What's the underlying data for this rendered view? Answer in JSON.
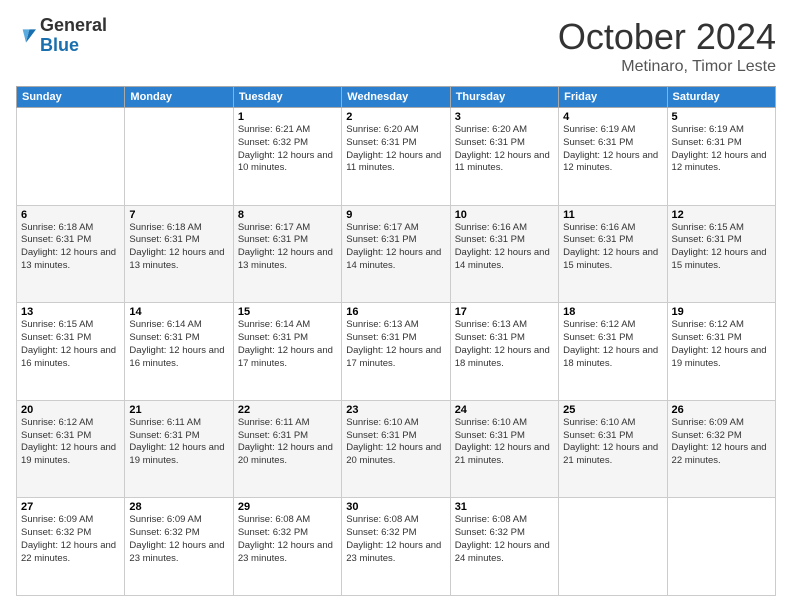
{
  "logo": {
    "general": "General",
    "blue": "Blue"
  },
  "header": {
    "month": "October 2024",
    "location": "Metinaro, Timor Leste"
  },
  "weekdays": [
    "Sunday",
    "Monday",
    "Tuesday",
    "Wednesday",
    "Thursday",
    "Friday",
    "Saturday"
  ],
  "weeks": [
    [
      {
        "day": null,
        "info": null
      },
      {
        "day": null,
        "info": null
      },
      {
        "day": "1",
        "info": "Sunrise: 6:21 AM\nSunset: 6:32 PM\nDaylight: 12 hours\nand 10 minutes."
      },
      {
        "day": "2",
        "info": "Sunrise: 6:20 AM\nSunset: 6:31 PM\nDaylight: 12 hours\nand 11 minutes."
      },
      {
        "day": "3",
        "info": "Sunrise: 6:20 AM\nSunset: 6:31 PM\nDaylight: 12 hours\nand 11 minutes."
      },
      {
        "day": "4",
        "info": "Sunrise: 6:19 AM\nSunset: 6:31 PM\nDaylight: 12 hours\nand 12 minutes."
      },
      {
        "day": "5",
        "info": "Sunrise: 6:19 AM\nSunset: 6:31 PM\nDaylight: 12 hours\nand 12 minutes."
      }
    ],
    [
      {
        "day": "6",
        "info": "Sunrise: 6:18 AM\nSunset: 6:31 PM\nDaylight: 12 hours\nand 13 minutes."
      },
      {
        "day": "7",
        "info": "Sunrise: 6:18 AM\nSunset: 6:31 PM\nDaylight: 12 hours\nand 13 minutes."
      },
      {
        "day": "8",
        "info": "Sunrise: 6:17 AM\nSunset: 6:31 PM\nDaylight: 12 hours\nand 13 minutes."
      },
      {
        "day": "9",
        "info": "Sunrise: 6:17 AM\nSunset: 6:31 PM\nDaylight: 12 hours\nand 14 minutes."
      },
      {
        "day": "10",
        "info": "Sunrise: 6:16 AM\nSunset: 6:31 PM\nDaylight: 12 hours\nand 14 minutes."
      },
      {
        "day": "11",
        "info": "Sunrise: 6:16 AM\nSunset: 6:31 PM\nDaylight: 12 hours\nand 15 minutes."
      },
      {
        "day": "12",
        "info": "Sunrise: 6:15 AM\nSunset: 6:31 PM\nDaylight: 12 hours\nand 15 minutes."
      }
    ],
    [
      {
        "day": "13",
        "info": "Sunrise: 6:15 AM\nSunset: 6:31 PM\nDaylight: 12 hours\nand 16 minutes."
      },
      {
        "day": "14",
        "info": "Sunrise: 6:14 AM\nSunset: 6:31 PM\nDaylight: 12 hours\nand 16 minutes."
      },
      {
        "day": "15",
        "info": "Sunrise: 6:14 AM\nSunset: 6:31 PM\nDaylight: 12 hours\nand 17 minutes."
      },
      {
        "day": "16",
        "info": "Sunrise: 6:13 AM\nSunset: 6:31 PM\nDaylight: 12 hours\nand 17 minutes."
      },
      {
        "day": "17",
        "info": "Sunrise: 6:13 AM\nSunset: 6:31 PM\nDaylight: 12 hours\nand 18 minutes."
      },
      {
        "day": "18",
        "info": "Sunrise: 6:12 AM\nSunset: 6:31 PM\nDaylight: 12 hours\nand 18 minutes."
      },
      {
        "day": "19",
        "info": "Sunrise: 6:12 AM\nSunset: 6:31 PM\nDaylight: 12 hours\nand 19 minutes."
      }
    ],
    [
      {
        "day": "20",
        "info": "Sunrise: 6:12 AM\nSunset: 6:31 PM\nDaylight: 12 hours\nand 19 minutes."
      },
      {
        "day": "21",
        "info": "Sunrise: 6:11 AM\nSunset: 6:31 PM\nDaylight: 12 hours\nand 19 minutes."
      },
      {
        "day": "22",
        "info": "Sunrise: 6:11 AM\nSunset: 6:31 PM\nDaylight: 12 hours\nand 20 minutes."
      },
      {
        "day": "23",
        "info": "Sunrise: 6:10 AM\nSunset: 6:31 PM\nDaylight: 12 hours\nand 20 minutes."
      },
      {
        "day": "24",
        "info": "Sunrise: 6:10 AM\nSunset: 6:31 PM\nDaylight: 12 hours\nand 21 minutes."
      },
      {
        "day": "25",
        "info": "Sunrise: 6:10 AM\nSunset: 6:31 PM\nDaylight: 12 hours\nand 21 minutes."
      },
      {
        "day": "26",
        "info": "Sunrise: 6:09 AM\nSunset: 6:32 PM\nDaylight: 12 hours\nand 22 minutes."
      }
    ],
    [
      {
        "day": "27",
        "info": "Sunrise: 6:09 AM\nSunset: 6:32 PM\nDaylight: 12 hours\nand 22 minutes."
      },
      {
        "day": "28",
        "info": "Sunrise: 6:09 AM\nSunset: 6:32 PM\nDaylight: 12 hours\nand 23 minutes."
      },
      {
        "day": "29",
        "info": "Sunrise: 6:08 AM\nSunset: 6:32 PM\nDaylight: 12 hours\nand 23 minutes."
      },
      {
        "day": "30",
        "info": "Sunrise: 6:08 AM\nSunset: 6:32 PM\nDaylight: 12 hours\nand 23 minutes."
      },
      {
        "day": "31",
        "info": "Sunrise: 6:08 AM\nSunset: 6:32 PM\nDaylight: 12 hours\nand 24 minutes."
      },
      {
        "day": null,
        "info": null
      },
      {
        "day": null,
        "info": null
      }
    ]
  ]
}
